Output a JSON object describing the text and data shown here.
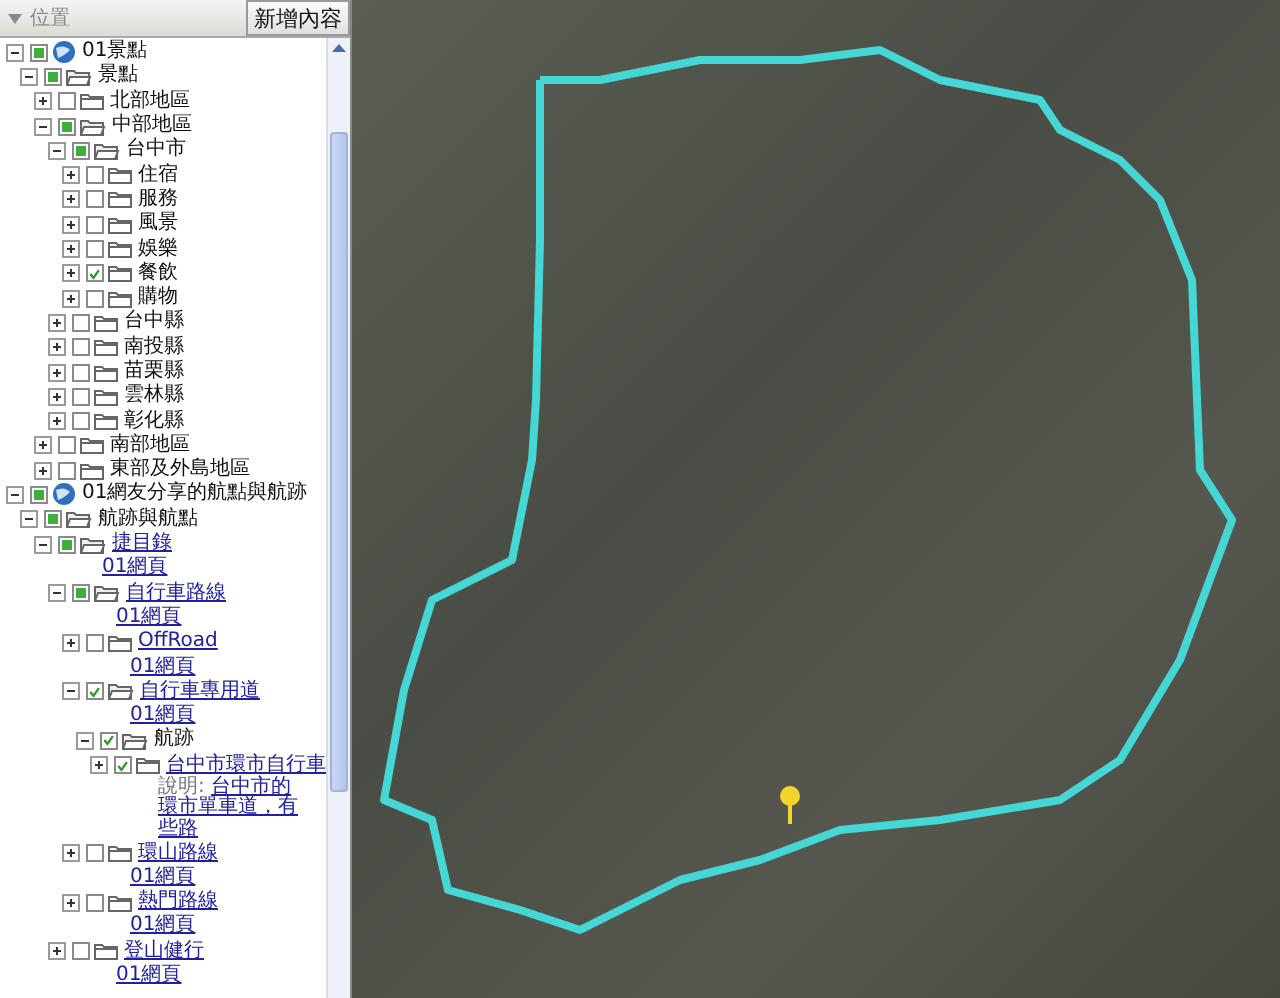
{
  "panel": {
    "title": "位置",
    "add_button": "新增內容"
  },
  "tree": [
    {
      "label": "01景點",
      "kind": "globe",
      "checked": true,
      "partial": true,
      "expanded": true,
      "children": [
        {
          "label": "景點",
          "kind": "folder",
          "checked": true,
          "partial": true,
          "expanded": true,
          "children": [
            {
              "label": "北部地區",
              "kind": "folder",
              "checked": false,
              "partial": false,
              "expanded": false
            },
            {
              "label": "中部地區",
              "kind": "folder",
              "checked": true,
              "partial": true,
              "expanded": true,
              "children": [
                {
                  "label": "台中市",
                  "kind": "folder",
                  "checked": true,
                  "partial": true,
                  "expanded": true,
                  "children": [
                    {
                      "label": "住宿",
                      "kind": "folder",
                      "checked": false,
                      "partial": false,
                      "expanded": false
                    },
                    {
                      "label": "服務",
                      "kind": "folder",
                      "checked": false,
                      "partial": false,
                      "expanded": false
                    },
                    {
                      "label": "風景",
                      "kind": "folder",
                      "checked": false,
                      "partial": false,
                      "expanded": false
                    },
                    {
                      "label": "娛樂",
                      "kind": "folder",
                      "checked": false,
                      "partial": false,
                      "expanded": false
                    },
                    {
                      "label": "餐飲",
                      "kind": "folder",
                      "checked": true,
                      "partial": false,
                      "expanded": false
                    },
                    {
                      "label": "購物",
                      "kind": "folder",
                      "checked": false,
                      "partial": false,
                      "expanded": false
                    }
                  ]
                },
                {
                  "label": "台中縣",
                  "kind": "folder",
                  "checked": false,
                  "partial": false,
                  "expanded": false
                },
                {
                  "label": "南投縣",
                  "kind": "folder",
                  "checked": false,
                  "partial": false,
                  "expanded": false
                },
                {
                  "label": "苗栗縣",
                  "kind": "folder",
                  "checked": false,
                  "partial": false,
                  "expanded": false
                },
                {
                  "label": "雲林縣",
                  "kind": "folder",
                  "checked": false,
                  "partial": false,
                  "expanded": false
                },
                {
                  "label": "彰化縣",
                  "kind": "folder",
                  "checked": false,
                  "partial": false,
                  "expanded": false
                }
              ]
            },
            {
              "label": "南部地區",
              "kind": "folder",
              "checked": false,
              "partial": false,
              "expanded": false
            },
            {
              "label": "東部及外島地區",
              "kind": "folder",
              "checked": false,
              "partial": false,
              "expanded": false
            }
          ]
        }
      ]
    },
    {
      "label": "01網友分享的航點與航跡",
      "kind": "globe",
      "checked": true,
      "partial": true,
      "expanded": true,
      "children": [
        {
          "label": "航跡與航點",
          "kind": "folder",
          "checked": true,
          "partial": true,
          "expanded": true,
          "children": [
            {
              "label": "捷目錄",
              "kind": "link",
              "checked": true,
              "partial": true,
              "expanded": true,
              "sublink": "01網頁",
              "children": [
                {
                  "label": "自行車路線",
                  "kind": "link",
                  "checked": true,
                  "partial": true,
                  "expanded": true,
                  "sublink": "01網頁",
                  "children": [
                    {
                      "label": "OffRoad",
                      "kind": "link",
                      "checked": false,
                      "partial": false,
                      "expanded": false,
                      "sublink": "01網頁"
                    },
                    {
                      "label": "自行車專用道",
                      "kind": "link",
                      "checked": true,
                      "partial": false,
                      "expanded": true,
                      "sublink": "01網頁",
                      "children": [
                        {
                          "label": "航跡",
                          "kind": "folder",
                          "checked": true,
                          "partial": false,
                          "expanded": true,
                          "children": [
                            {
                              "label": "台中市環市自行車",
                              "kind": "link",
                              "checked": true,
                              "partial": false,
                              "expanded": false,
                              "desc_label": "說明:",
                              "desc": "台中市的環市單車道，有些路"
                            }
                          ]
                        }
                      ]
                    },
                    {
                      "label": "環山路線",
                      "kind": "link",
                      "checked": false,
                      "partial": false,
                      "expanded": false,
                      "sublink": "01網頁"
                    },
                    {
                      "label": "熱門路線",
                      "kind": "link",
                      "checked": false,
                      "partial": false,
                      "expanded": false,
                      "sublink": "01網頁"
                    }
                  ]
                },
                {
                  "label": "登山健行",
                  "kind": "link",
                  "checked": false,
                  "partial": false,
                  "expanded": false,
                  "sublink": "01網頁"
                }
              ]
            }
          ]
        }
      ]
    }
  ]
}
